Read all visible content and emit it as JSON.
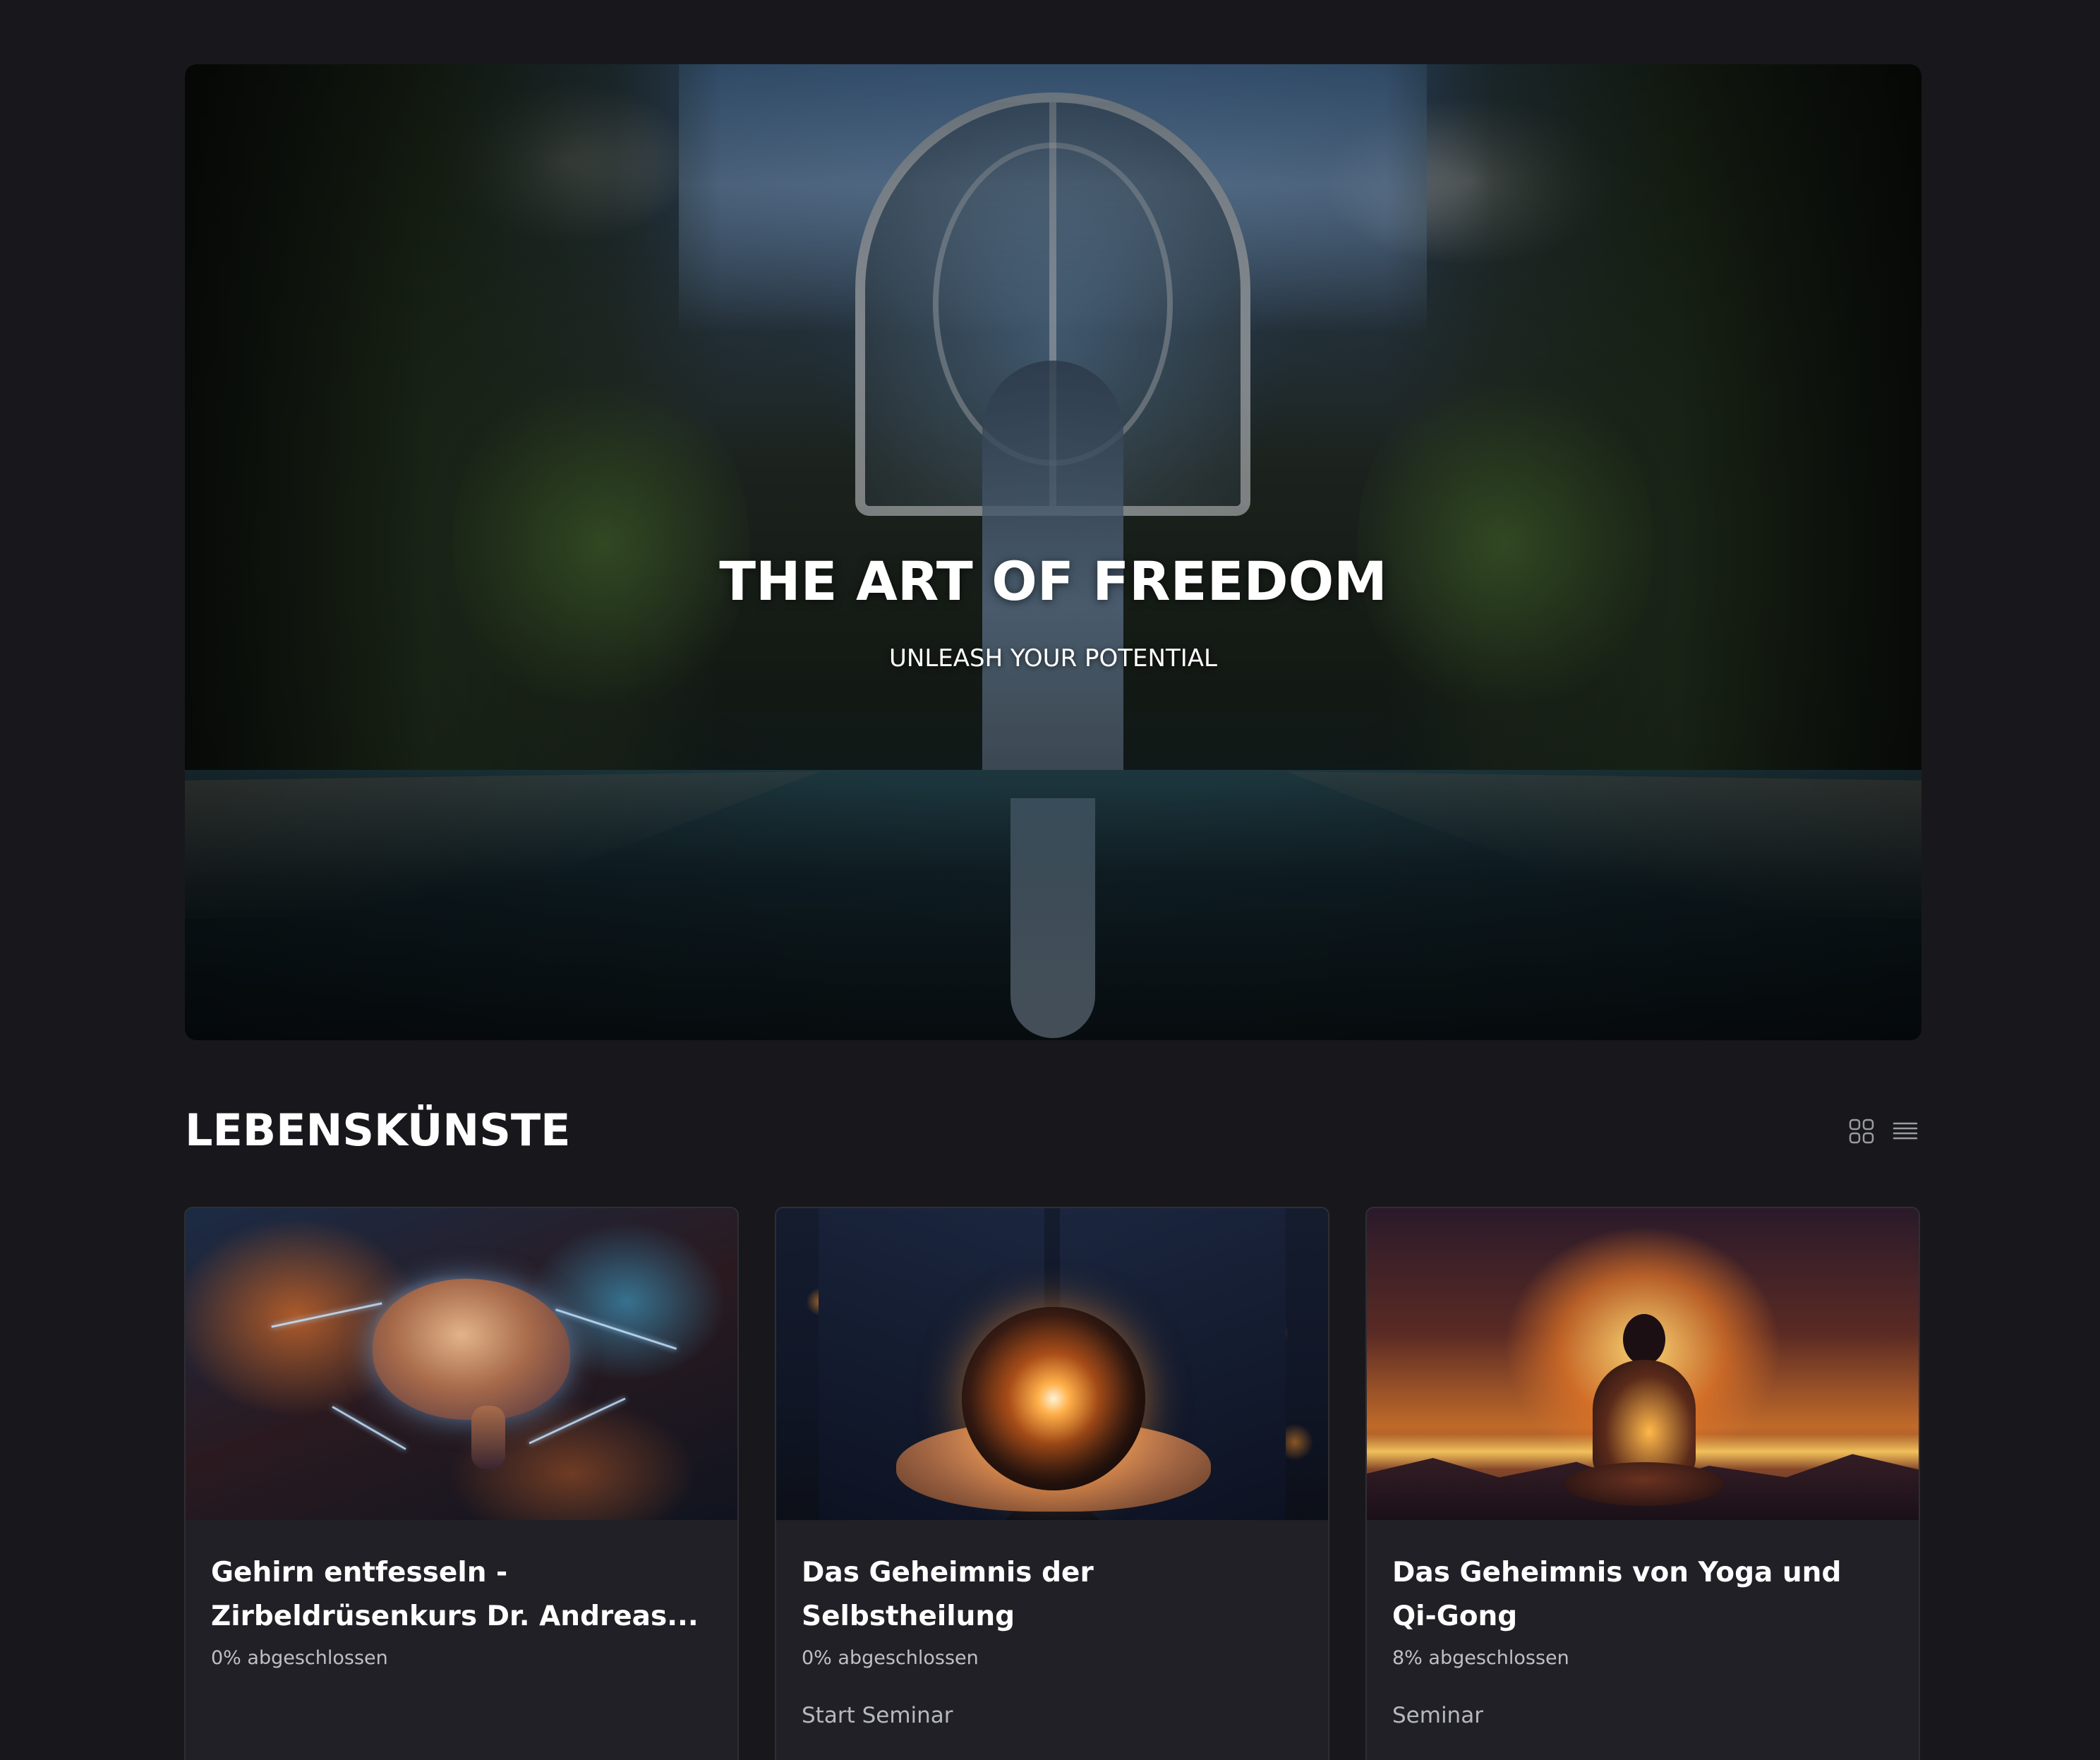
{
  "hero": {
    "title": "THE ART OF FREEDOM",
    "subtitle": "UNLEASH YOUR POTENTIAL"
  },
  "section": {
    "title": "LEBENSKÜNSTE",
    "view_icons": [
      "grid-view-icon",
      "list-view-icon"
    ]
  },
  "courses": [
    {
      "title": "Gehirn entfesseln - Zirbeldrüsenkurs Dr. Andreas...",
      "progress": "0% abgeschlossen",
      "action": ""
    },
    {
      "title": "Das Geheimnis der Selbstheilung",
      "progress": "0% abgeschlossen",
      "action": "Start Seminar"
    },
    {
      "title": "Das Geheimnis von Yoga und Qi-Gong",
      "progress": "8% abgeschlossen",
      "action": "Seminar"
    }
  ],
  "colors": {
    "background": "#18181c",
    "card": "#202026",
    "card_border": "#2e2e35",
    "muted_text": "#bfc0c6"
  }
}
